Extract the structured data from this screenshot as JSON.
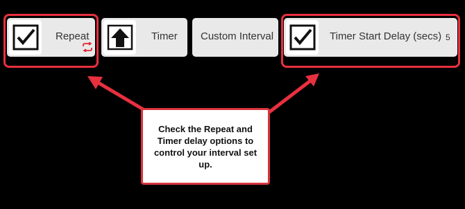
{
  "toolbar": {
    "repeat": {
      "label": "Repeat",
      "checked": true
    },
    "timer": {
      "label": "Timer"
    },
    "custom_interval": {
      "label": "Custom Interval"
    },
    "timer_start_delay": {
      "label": "Timer Start Delay (secs)",
      "checked": true,
      "value": "5"
    }
  },
  "callout": {
    "text": "Check the Repeat and Timer delay options to control your interval set up."
  },
  "colors": {
    "background": "#000000",
    "button_bg": "#e9e9e9",
    "highlight_red": "#e8303f",
    "repeat_icon_red": "#e4242f"
  }
}
